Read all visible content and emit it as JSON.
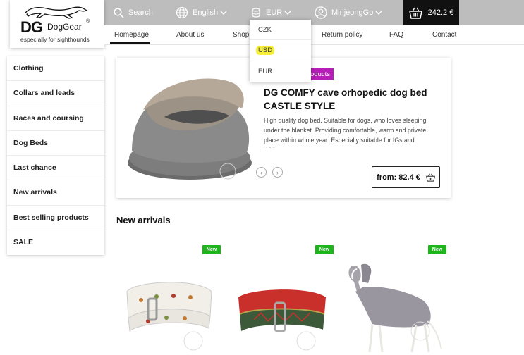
{
  "logo": {
    "brand": "DG",
    "brand_name": "DogGear",
    "registered": "®",
    "tagline": "especially for sighthounds"
  },
  "topbar": {
    "search_label": "Search",
    "language_label": "English",
    "currency_label": "EUR",
    "user_label": "MinjeongGo",
    "cart_total": "242.2 €",
    "bg_color": "#bdbdbd"
  },
  "currency_dropdown": {
    "options": [
      "CZK",
      "USD",
      "EUR"
    ],
    "highlighted": "USD"
  },
  "nav": {
    "items": [
      "Homepage",
      "About us",
      "Shopp",
      "Return policy",
      "FAQ",
      "Contact"
    ],
    "active": "Homepage"
  },
  "sidebar": {
    "categories": [
      "Clothing",
      "Collars and leads",
      "Races and coursing",
      "Dog Beds",
      "Last chance",
      "New arrivals",
      "Best selling products",
      "SALE"
    ]
  },
  "hero": {
    "badge": "oducts",
    "title": "DG COMFY cave orhopedic dog bed CASTLE STYLE",
    "description": "High quality dog bed. Suitable for dogs, who loves sleeping under the blanket. Providing comfortable, warm and private place within whole year.   Especially suitable for IGs and Whippets.",
    "price": "from: 82.4 €",
    "badge_color": "#b51fb5"
  },
  "new_arrivals": {
    "title": "New arrivals",
    "badge_label": "New",
    "badge_color": "#1db41d"
  }
}
